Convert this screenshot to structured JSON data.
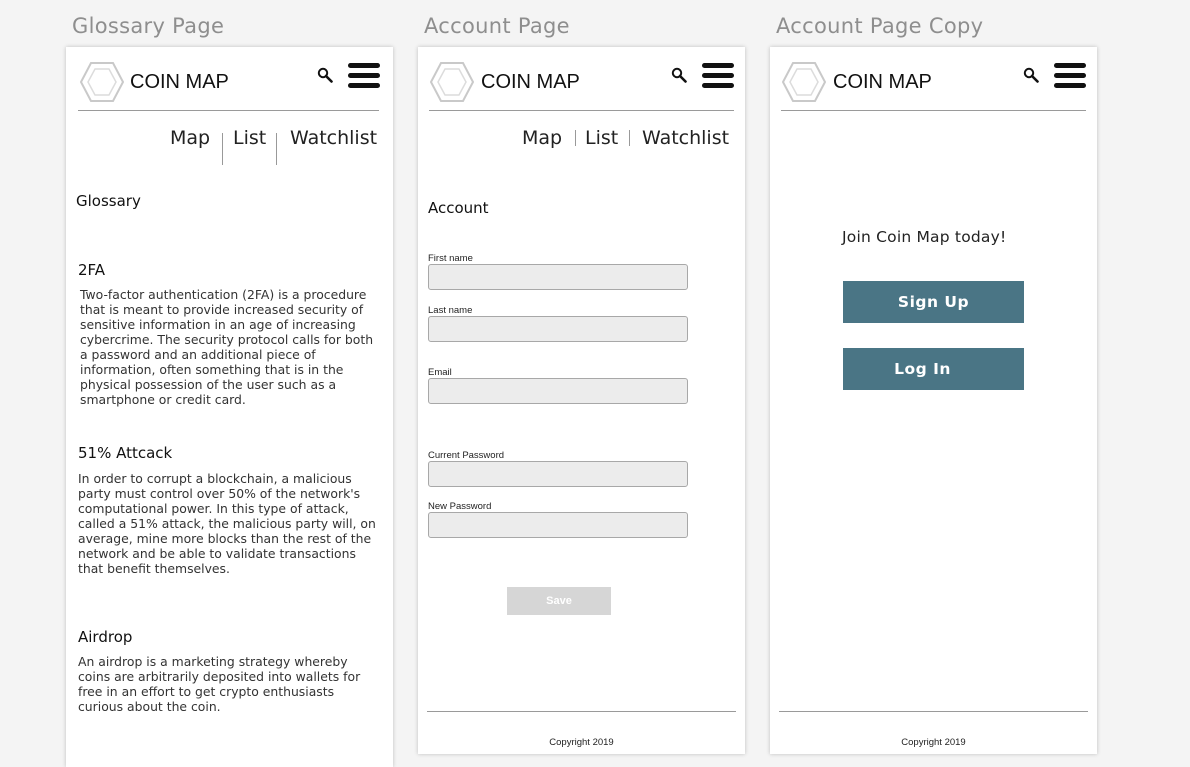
{
  "artboards": {
    "glossary_title": "Glossary Page",
    "account_title": "Account Page",
    "copy_title": "Account Page Copy"
  },
  "brand": "COIN MAP",
  "icons": {
    "logo": "hexagon-logo-icon",
    "search": "search-icon",
    "menu": "hamburger-menu-icon"
  },
  "nav": {
    "map": "Map",
    "list": "List",
    "watchlist": "Watchlist"
  },
  "glossary": {
    "heading": "Glossary",
    "entries": [
      {
        "term": "2FA",
        "definition": "Two-factor authentication (2FA) is a procedure that is meant to provide increased security of sensitive information in an age of increasing cybercrime. The security protocol calls for both a password and an additional piece of information, often something that is in the physical possession of the user such as a smartphone or credit card."
      },
      {
        "term": "51% Attcack",
        "definition": "In order to corrupt a blockchain, a malicious party must control over 50% of the network's computational power. In this type of attack, called a 51% attack, the malicious party will, on average, mine more blocks than the rest of the network and be able to validate transactions that benefit themselves."
      },
      {
        "term": "Airdrop",
        "definition": "An airdrop is a marketing strategy whereby coins are arbitrarily deposited into wallets for free in an effort to get crypto enthusiasts curious about the coin."
      }
    ]
  },
  "account": {
    "heading": "Account",
    "fields": [
      {
        "label": "First name",
        "value": ""
      },
      {
        "label": "Last name",
        "value": ""
      },
      {
        "label": "Email",
        "value": ""
      },
      {
        "label": "Current Password",
        "value": ""
      },
      {
        "label": "New Password",
        "value": ""
      }
    ],
    "save_label": "Save",
    "copyright": "Copyright 2019"
  },
  "account_copy": {
    "join_text": "Join Coin Map today!",
    "signup_label": "Sign Up",
    "login_label": "Log In",
    "copyright": "Copyright 2019"
  },
  "colors": {
    "cta": "#4a7585",
    "input_bg": "#ececec",
    "save_bg": "#d6d6d6"
  }
}
